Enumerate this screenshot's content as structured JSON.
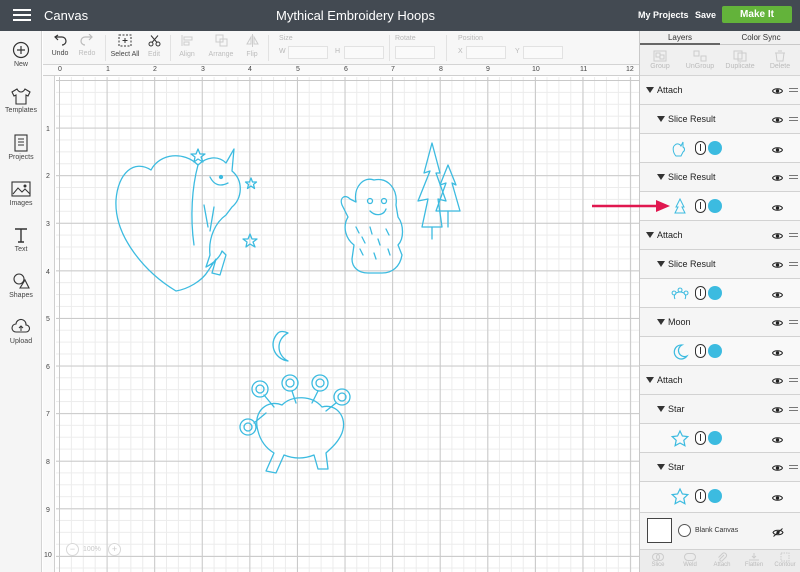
{
  "header": {
    "app_title": "Canvas",
    "doc_title": "Mythical Embroidery Hoops",
    "my_projects": "My Projects",
    "save": "Save",
    "make_it": "Make It"
  },
  "colors": {
    "header": "#434a52",
    "make_it": "#63b33a",
    "art": "#3cbbe0",
    "arrow": "#e0174f"
  },
  "sidebar": {
    "items": [
      {
        "label": "New",
        "icon": "plus-circle-icon"
      },
      {
        "label": "Templates",
        "icon": "tshirt-icon"
      },
      {
        "label": "Projects",
        "icon": "projects-icon"
      },
      {
        "label": "Images",
        "icon": "image-icon"
      },
      {
        "label": "Text",
        "icon": "text-icon"
      },
      {
        "label": "Shapes",
        "icon": "shapes-icon"
      },
      {
        "label": "Upload",
        "icon": "cloud-upload-icon"
      }
    ]
  },
  "toolbar": {
    "undo": "Undo",
    "redo": "Redo",
    "select_all": "Select All",
    "edit": "Edit",
    "align": "Align",
    "arrange": "Arrange",
    "flip": "Flip",
    "size": "Size",
    "w": "W",
    "h": "H",
    "rotate": "Rotate",
    "position": "Position",
    "x": "X",
    "y": "Y"
  },
  "ruler": {
    "top": [
      "0",
      "1",
      "2",
      "3",
      "4",
      "5",
      "6",
      "7",
      "8",
      "9",
      "10",
      "11",
      "12"
    ],
    "left": [
      "1",
      "2",
      "3",
      "4",
      "5",
      "6",
      "7",
      "8",
      "9",
      "10"
    ]
  },
  "zoom": {
    "level": "100%",
    "minus": "−",
    "plus": "+"
  },
  "panel": {
    "tabs": [
      "Layers",
      "Color Sync"
    ],
    "tools": [
      "Group",
      "UnGroup",
      "Duplicate",
      "Delete"
    ],
    "rows": [
      {
        "label": "Attach"
      },
      {
        "label": "Slice Result"
      },
      {
        "label": "Slice Result"
      },
      {
        "label": "Attach"
      },
      {
        "label": "Slice Result"
      },
      {
        "label": "Moon"
      },
      {
        "label": "Attach"
      },
      {
        "label": "Star"
      },
      {
        "label": "Star"
      }
    ],
    "blank_canvas": "Blank Canvas",
    "bottom_tools": [
      "Slice",
      "Weld",
      "Attach",
      "Flatten",
      "Contour"
    ]
  }
}
